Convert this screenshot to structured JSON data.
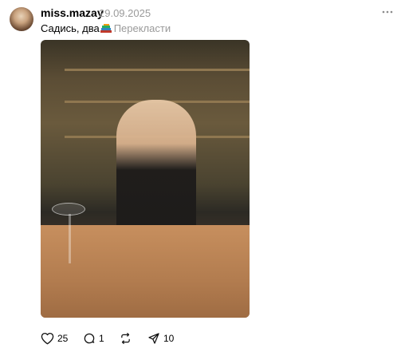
{
  "post": {
    "username": "miss.mazay",
    "date": "29.09.2025",
    "caption": "Садись, два",
    "caption_emoji": "books-emoji",
    "translate_label": "Перекласти",
    "image_alt": ""
  },
  "actions": {
    "like_count": "25",
    "comment_count": "1",
    "repost_count": "",
    "share_count": "10"
  },
  "colors": {
    "secondary_text": "#9a9a9a",
    "primary_text": "#000000"
  }
}
